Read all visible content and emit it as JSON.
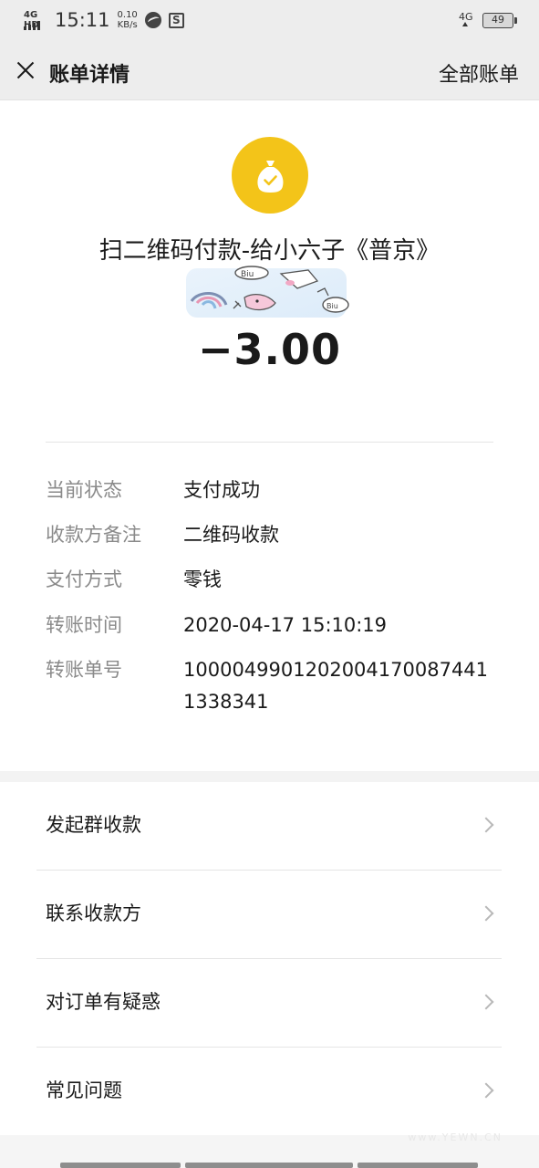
{
  "status_bar": {
    "network": "4G HD",
    "time": "15:11",
    "speed_value": "0.10",
    "speed_unit": "KB/s",
    "signal_type": "4G",
    "battery": "49"
  },
  "nav": {
    "title": "账单详情",
    "right_link": "全部账单"
  },
  "transaction": {
    "payee": "扫二维码付款-给小六子《普京》",
    "amount": "−3.00",
    "icon": "money-bag-check-icon",
    "icon_color": "#f3c419"
  },
  "details": [
    {
      "label": "当前状态",
      "value": "支付成功"
    },
    {
      "label": "收款方备注",
      "value": "二维码收款"
    },
    {
      "label": "支付方式",
      "value": "零钱"
    },
    {
      "label": "转账时间",
      "value": "2020-04-17 15:10:19"
    },
    {
      "label": "转账单号",
      "value": "100004990120200417008744​11338341"
    }
  ],
  "actions": [
    {
      "label": "发起群收款"
    },
    {
      "label": "联系收款方"
    },
    {
      "label": "对订单有疑惑"
    },
    {
      "label": "常见问题"
    }
  ],
  "watermark": "www.YEWN.CN"
}
